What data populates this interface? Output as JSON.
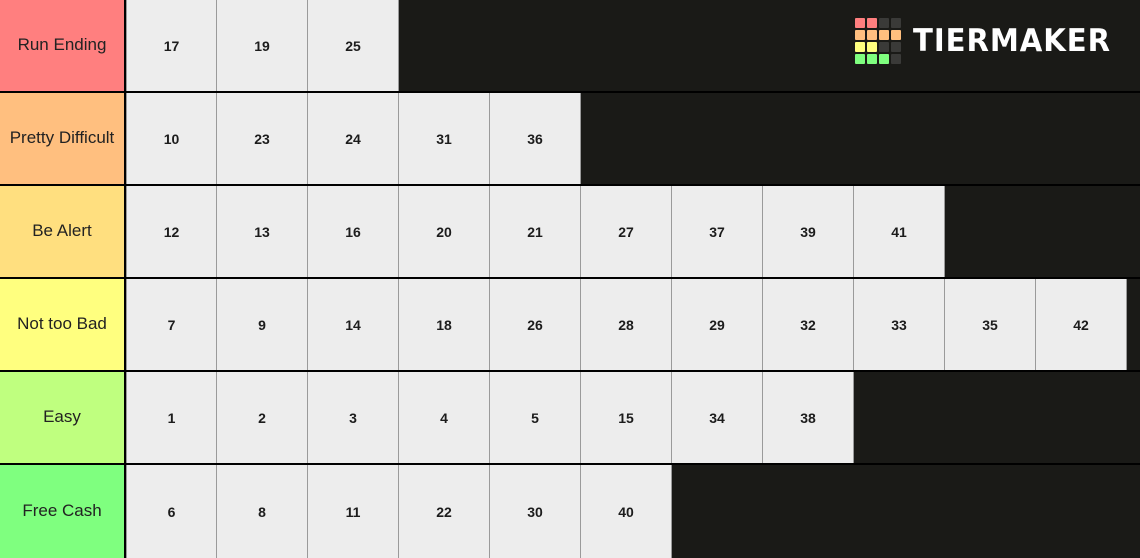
{
  "app": {
    "watermark_text": "TIERMAKER",
    "background_color": "#1a1a17",
    "tile_background_color": "#ededed",
    "tile_text_color": "#1c1c1c"
  },
  "logo": {
    "name": "tiermaker-logo",
    "grid_colors": [
      "#ff7f7f",
      "#ff7f7f",
      "#3a3a38",
      "#3a3a38",
      "#ffbf7f",
      "#ffbf7f",
      "#ffbf7f",
      "#ffbf7f",
      "#ffff7f",
      "#ffff7f",
      "#3a3a38",
      "#3a3a38",
      "#7fff7f",
      "#7fff7f",
      "#7fff7f",
      "#3a3a38"
    ]
  },
  "tiers": [
    {
      "label": "Run Ending",
      "color": "#ff7f7f",
      "items": [
        "17",
        "19",
        "25"
      ]
    },
    {
      "label": "Pretty Difficult",
      "color": "#ffbf7f",
      "items": [
        "10",
        "23",
        "24",
        "31",
        "36"
      ]
    },
    {
      "label": "Be Alert",
      "color": "#ffdf7f",
      "items": [
        "12",
        "13",
        "16",
        "20",
        "21",
        "27",
        "37",
        "39",
        "41"
      ]
    },
    {
      "label": "Not too Bad",
      "color": "#ffff7f",
      "items": [
        "7",
        "9",
        "14",
        "18",
        "26",
        "28",
        "29",
        "32",
        "33",
        "35",
        "42"
      ]
    },
    {
      "label": "Easy",
      "color": "#bfff7f",
      "items": [
        "1",
        "2",
        "3",
        "4",
        "5",
        "15",
        "34",
        "38"
      ]
    },
    {
      "label": "Free Cash",
      "color": "#7fff7f",
      "items": [
        "6",
        "8",
        "11",
        "22",
        "30",
        "40"
      ]
    }
  ]
}
